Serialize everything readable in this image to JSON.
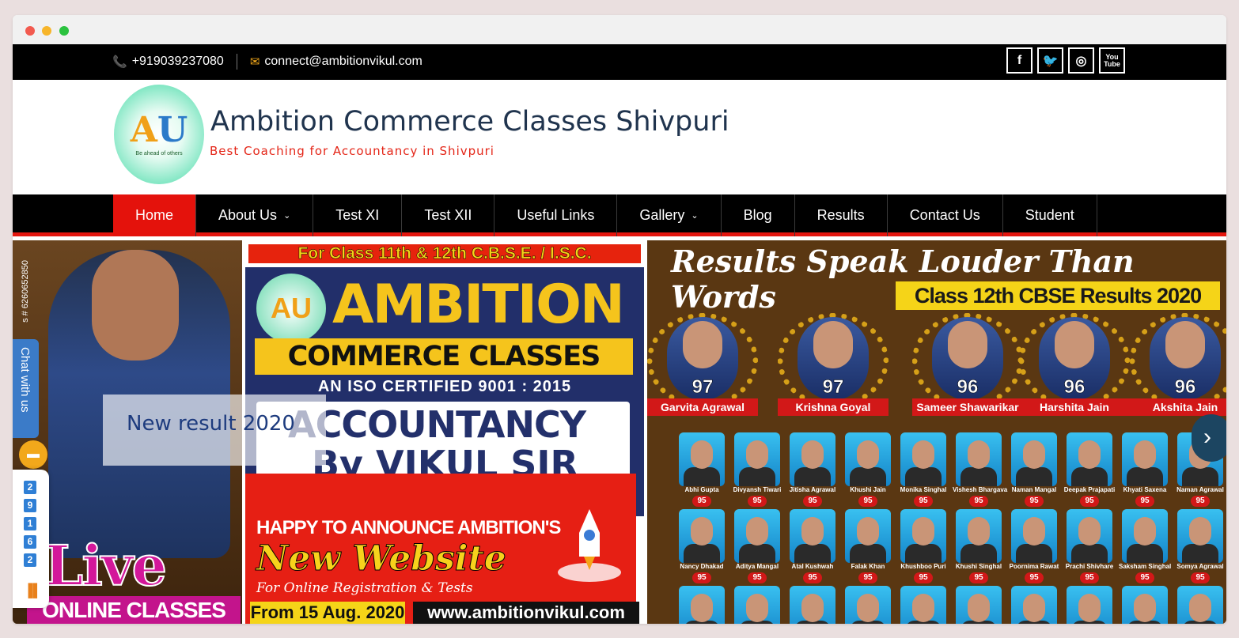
{
  "topbar": {
    "phone_icon": "phone-icon",
    "phone": "+919039237080",
    "email_icon": "envelope-icon",
    "email": "connect@ambitionvikul.com",
    "social": [
      {
        "name": "facebook-icon",
        "glyph": "f"
      },
      {
        "name": "twitter-icon",
        "glyph": "🐦"
      },
      {
        "name": "instagram-icon",
        "glyph": "◎"
      },
      {
        "name": "youtube-icon",
        "glyph": "You Tube"
      }
    ]
  },
  "brand": {
    "logo_tagline": "Be ahead of others",
    "title": "Ambition Commerce Classes Shivpuri",
    "tagline": "Best Coaching for Accountancy in Shivpuri"
  },
  "nav": {
    "items": [
      {
        "label": "Home",
        "active": true
      },
      {
        "label": "About Us",
        "dropdown": true
      },
      {
        "label": "Test XI"
      },
      {
        "label": "Test XII"
      },
      {
        "label": "Useful Links"
      },
      {
        "label": "Gallery",
        "dropdown": true
      },
      {
        "label": "Blog"
      },
      {
        "label": "Results"
      },
      {
        "label": "Contact Us"
      },
      {
        "label": "Student"
      }
    ]
  },
  "slider": {
    "left": {
      "live": "Live",
      "online": "ONLINE CLASSES"
    },
    "center": {
      "ribbon": "For Class 11th & 12th C.B.S.E. / I.S.C.",
      "ambition": "AMBITION",
      "commerce_classes": "COMMERCE CLASSES",
      "iso": "AN ISO CERTIFIED 9001 : 2015",
      "accountancy": "ACCOUNTANCY",
      "by_vikul": "By VIKUL SIR",
      "happy": "HAPPY TO ANNOUNCE AMBITION'S",
      "new_website": "New Website",
      "for_reg": "For Online Registration & Tests",
      "from": "From 15 Aug. 2020",
      "www": "www.ambitionvikul.com"
    },
    "right": {
      "title": "Results Speak Louder Than Words",
      "subtitle": "Class 12th CBSE Results 2020",
      "toppers": [
        {
          "name": "Garvita Agrawal",
          "score": "97"
        },
        {
          "name": "Krishna Goyal",
          "score": "97"
        },
        {
          "name": "Sameer Shawarikar",
          "score": "96"
        },
        {
          "name": "Harshita Jain",
          "score": "96"
        },
        {
          "name": "Akshita Jain",
          "score": "96"
        }
      ],
      "students_row1": [
        {
          "name": "Abhi Gupta",
          "score": "95"
        },
        {
          "name": "Divyansh Tiwari",
          "score": "95"
        },
        {
          "name": "Jitisha Agrawal",
          "score": "95"
        },
        {
          "name": "Khushi Jain",
          "score": "95"
        },
        {
          "name": "Monika Singhal",
          "score": "95"
        },
        {
          "name": "Vishesh Bhargava",
          "score": "95"
        },
        {
          "name": "Naman Mangal",
          "score": "95"
        },
        {
          "name": "Deepak Prajapati",
          "score": "95"
        },
        {
          "name": "Khyati Saxena",
          "score": "95"
        },
        {
          "name": "Naman Agrawal",
          "score": "95"
        }
      ],
      "students_row2": [
        {
          "name": "Nancy Dhakad",
          "score": "95"
        },
        {
          "name": "Aditya Mangal",
          "score": "95"
        },
        {
          "name": "Atal Kushwah",
          "score": "95"
        },
        {
          "name": "Falak Khan",
          "score": "95"
        },
        {
          "name": "Khushboo Puri",
          "score": "95"
        },
        {
          "name": "Khushi Singhal",
          "score": "95"
        },
        {
          "name": "Poornima Rawat",
          "score": "95"
        },
        {
          "name": "Prachi Shivhare",
          "score": "95"
        },
        {
          "name": "Saksham Singhal",
          "score": "95"
        },
        {
          "name": "Somya Agrawal",
          "score": "95"
        }
      ]
    },
    "caption": "New result 2020",
    "next_icon": "chevron-right-icon"
  },
  "widgets": {
    "chat_label": "Chat with us",
    "phone_vertical": "s # 6260652850",
    "chat_icon": "chat-bubble-icon",
    "counter_digits": [
      "2",
      "9",
      "1",
      "6",
      "2"
    ],
    "counter_icon": "bar-chart-icon"
  },
  "colors": {
    "accent_red": "#e4120c",
    "nav_bg": "#000000",
    "title_color": "#20344e",
    "tagline_color": "#e42517"
  }
}
